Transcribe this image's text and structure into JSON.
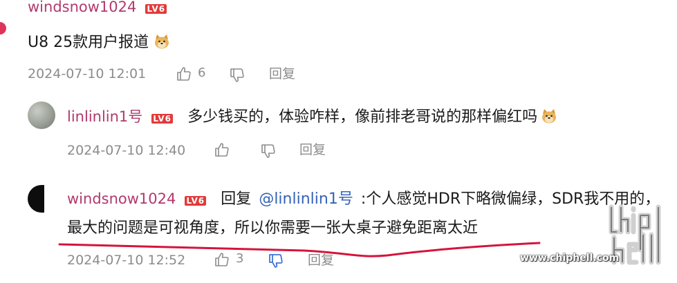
{
  "comment1": {
    "username": "windsnow1024",
    "level": "LV6",
    "content": "U8 25款用户报道",
    "emoji": "doge-emoji",
    "timestamp": "2024-07-10 12:01",
    "likes": "6",
    "reply_label": "回复"
  },
  "reply1": {
    "username": "linlinlin1号",
    "level": "LV6",
    "content": "多少钱买的，体验咋样，像前排老哥说的那样偏红吗",
    "emoji": "doge-emoji",
    "timestamp": "2024-07-10 12:40",
    "reply_label": "回复"
  },
  "reply2": {
    "username": "windsnow1024",
    "level": "LV6",
    "reply_prefix": "回复",
    "mention": "@linlinlin1号",
    "content_line1": ":个人感觉HDR下略微偏绿，SDR我不用的，",
    "content_line2": "最大的问题是可视角度，所以你需要一张大桌子避免距离太近",
    "timestamp": "2024-07-10 12:52",
    "likes": "3",
    "reply_label": "回复"
  },
  "watermark": {
    "url": "www.chiphell.com"
  },
  "colors": {
    "username": "#b2396d",
    "level_badge": "#e23a3a",
    "mention": "#3563b8",
    "meta": "#8c8c8c",
    "underline_annotation": "#d4143c",
    "dislike_active": "#3f73d9"
  }
}
